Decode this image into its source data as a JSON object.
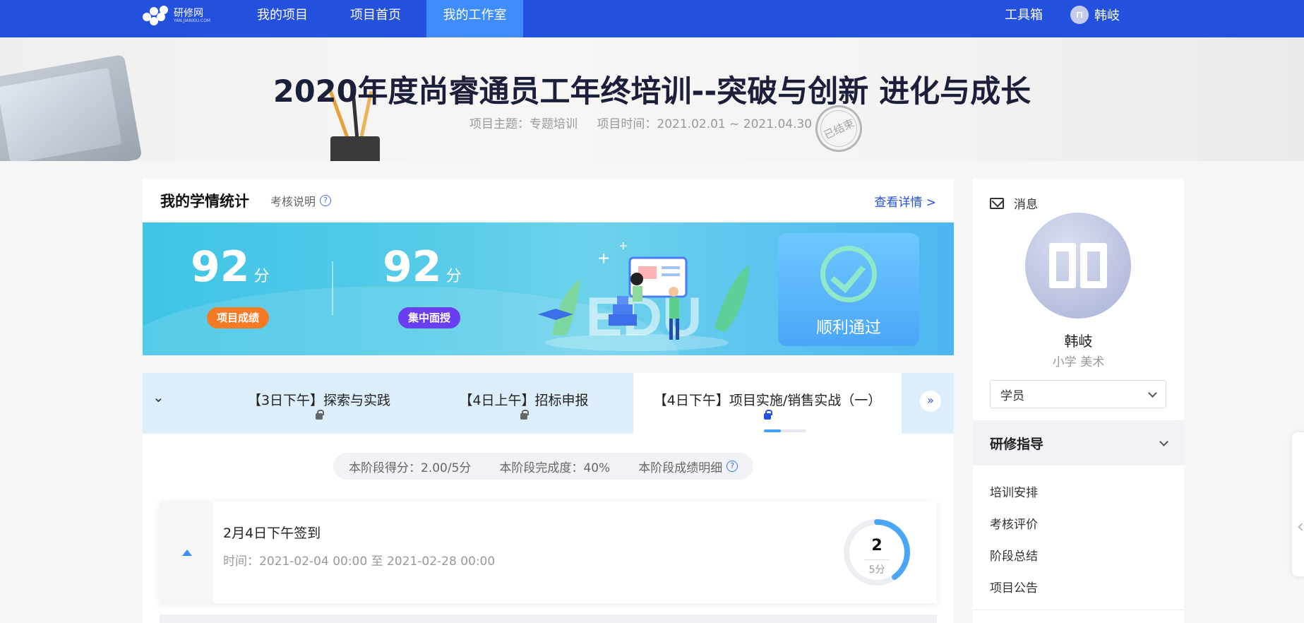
{
  "nav": {
    "logo_text": "研修网",
    "logo_sub": "YAN.JIANXIU.COM",
    "items": [
      {
        "label": "我的项目"
      },
      {
        "label": "项目首页"
      },
      {
        "label": "我的工作室"
      }
    ],
    "toolbox": "工具箱",
    "username": "韩岐"
  },
  "banner": {
    "title": "2020年度尚睿通员工年终培训--突破与创新 进化与成长",
    "theme": "项目主题：专题培训",
    "time": "项目时间：2021.02.01 ~ 2021.04.30",
    "stamp": "已结束"
  },
  "stats": {
    "title": "我的学情统计",
    "explain": "考核说明",
    "more": "查看详情",
    "scores": [
      {
        "value": "92",
        "unit": "分",
        "tag": "项目成绩"
      },
      {
        "value": "92",
        "unit": "分",
        "tag": "集中面授"
      }
    ],
    "edu_text": "EDU",
    "pass": "顺利通过"
  },
  "stages": {
    "tabs": [
      {
        "label": "【3日下午】探索与实践"
      },
      {
        "label": "【4日上午】招标申报"
      },
      {
        "label": "【4日下午】项目实施/销售实战（一）"
      }
    ],
    "active_progress": 0.4,
    "summary": {
      "score": "本阶段得分：2.00/5分",
      "completion": "本阶段完成度：40%",
      "detail": "本阶段成绩明细"
    },
    "task": {
      "title": "2月4日下午签到",
      "time": "时间：2021-02-04 00:00 至 2021-02-28 00:00",
      "score": "2",
      "total": "5分",
      "score_fraction": 0.4
    }
  },
  "side": {
    "message": "消息",
    "name": "韩岐",
    "sub": "小学 美术",
    "role": "学员",
    "guide_title": "研修指导",
    "guide_items": [
      {
        "label": "培训安排"
      },
      {
        "label": "考核评价"
      },
      {
        "label": "阶段总结"
      },
      {
        "label": "项目公告"
      }
    ]
  },
  "colors": {
    "nav_bg": "#2450de",
    "nav_active": "#3f8dfb",
    "tag_orange": "#f47a24",
    "tag_purple": "#6a3ef0",
    "ring": "#4aa6f7"
  }
}
